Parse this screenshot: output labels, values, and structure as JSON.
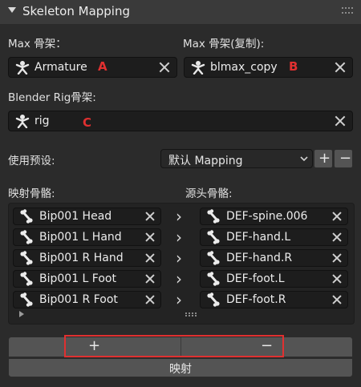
{
  "panel": {
    "title": "Skeleton Mapping"
  },
  "max_armature": {
    "label": "Max 骨架：",
    "value": "Armature",
    "marker": "A"
  },
  "max_copy": {
    "label": "Max 骨架(复制):",
    "value": "blmax_copy",
    "marker": "B"
  },
  "blender_rig": {
    "label": "Blender Rig骨架:",
    "value": "rig",
    "marker": "C"
  },
  "preset": {
    "label": "使用预设:",
    "selected": "默认 Mapping",
    "add_label": "+",
    "remove_label": "−"
  },
  "mapping": {
    "left_header": "映射骨骼:",
    "right_header": "源头骨骼:",
    "rows": [
      {
        "target": "Bip001 Head",
        "source": "DEF-spine.006"
      },
      {
        "target": "Bip001 L Hand",
        "source": "DEF-hand.L"
      },
      {
        "target": "Bip001 R Hand",
        "source": "DEF-hand.R"
      },
      {
        "target": "Bip001 L Foot",
        "source": "DEF-foot.L"
      },
      {
        "target": "Bip001 R Foot",
        "source": "DEF-foot.R"
      }
    ]
  },
  "actions": {
    "add_label": "+",
    "remove_label": "−",
    "map_label": "映射"
  },
  "colors": {
    "highlight": "#e03030",
    "background": "#2b2b2b",
    "field": "#1d1d1d"
  }
}
